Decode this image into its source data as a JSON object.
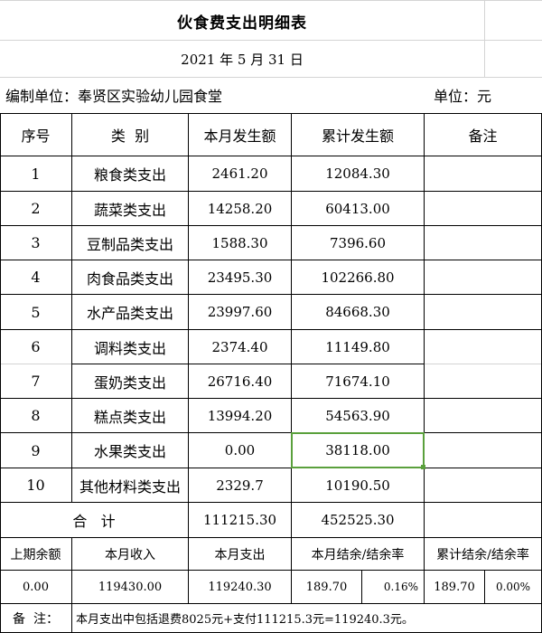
{
  "title": "伙食费支出明细表",
  "date": "2021 年 5 月 31 日",
  "unit_left": "编制单位：奉贤区实验幼儿园食堂",
  "unit_right": "单位：元",
  "headers": {
    "no": "序号",
    "type": "类  别",
    "month": "本月发生额",
    "cumulative": "累计发生额",
    "remark": "备注"
  },
  "rows": [
    {
      "no": "1",
      "type": "粮食类支出",
      "month": "2461.20",
      "cumulative": "12084.30"
    },
    {
      "no": "2",
      "type": "蔬菜类支出",
      "month": "14258.20",
      "cumulative": "60413.00"
    },
    {
      "no": "3",
      "type": "豆制品类支出",
      "month": "1588.30",
      "cumulative": "7396.60"
    },
    {
      "no": "4",
      "type": "肉食品类支出",
      "month": "23495.30",
      "cumulative": "102266.80"
    },
    {
      "no": "5",
      "type": "水产品类支出",
      "month": "23997.60",
      "cumulative": "84668.30"
    },
    {
      "no": "6",
      "type": "调料类支出",
      "month": "2374.40",
      "cumulative": "11149.80"
    },
    {
      "no": "7",
      "type": "蛋奶类支出",
      "month": "26716.40",
      "cumulative": "71674.10"
    },
    {
      "no": "8",
      "type": "糕点类支出",
      "month": "13994.20",
      "cumulative": "54563.90"
    },
    {
      "no": "9",
      "type": "水果类支出",
      "month": "0.00",
      "cumulative": "38118.00"
    },
    {
      "no": "10",
      "type": "其他材料类支出",
      "month": "2329.7",
      "cumulative": "10190.50"
    }
  ],
  "total": {
    "label": "合   计",
    "month": "111215.30",
    "cumulative": "452525.30"
  },
  "summary_headers": {
    "prev_balance": "上期余额",
    "month_income": "本月收入",
    "month_expense": "本月支出",
    "month_surplus": "本月结余/结余率",
    "cum_surplus": "累计结余/结余率"
  },
  "summary_values": {
    "prev_balance": "0.00",
    "month_income": "119430.00",
    "month_expense": "119240.30",
    "month_surplus": "189.70",
    "month_rate": "0.16%",
    "cum_surplus": "189.70",
    "cum_rate": "0.00%"
  },
  "note_label": "备  注：",
  "note_text": "本月支出中包括退费8025元+支付111215.3元=119240.3元。",
  "accent_color": "#5aa03c"
}
